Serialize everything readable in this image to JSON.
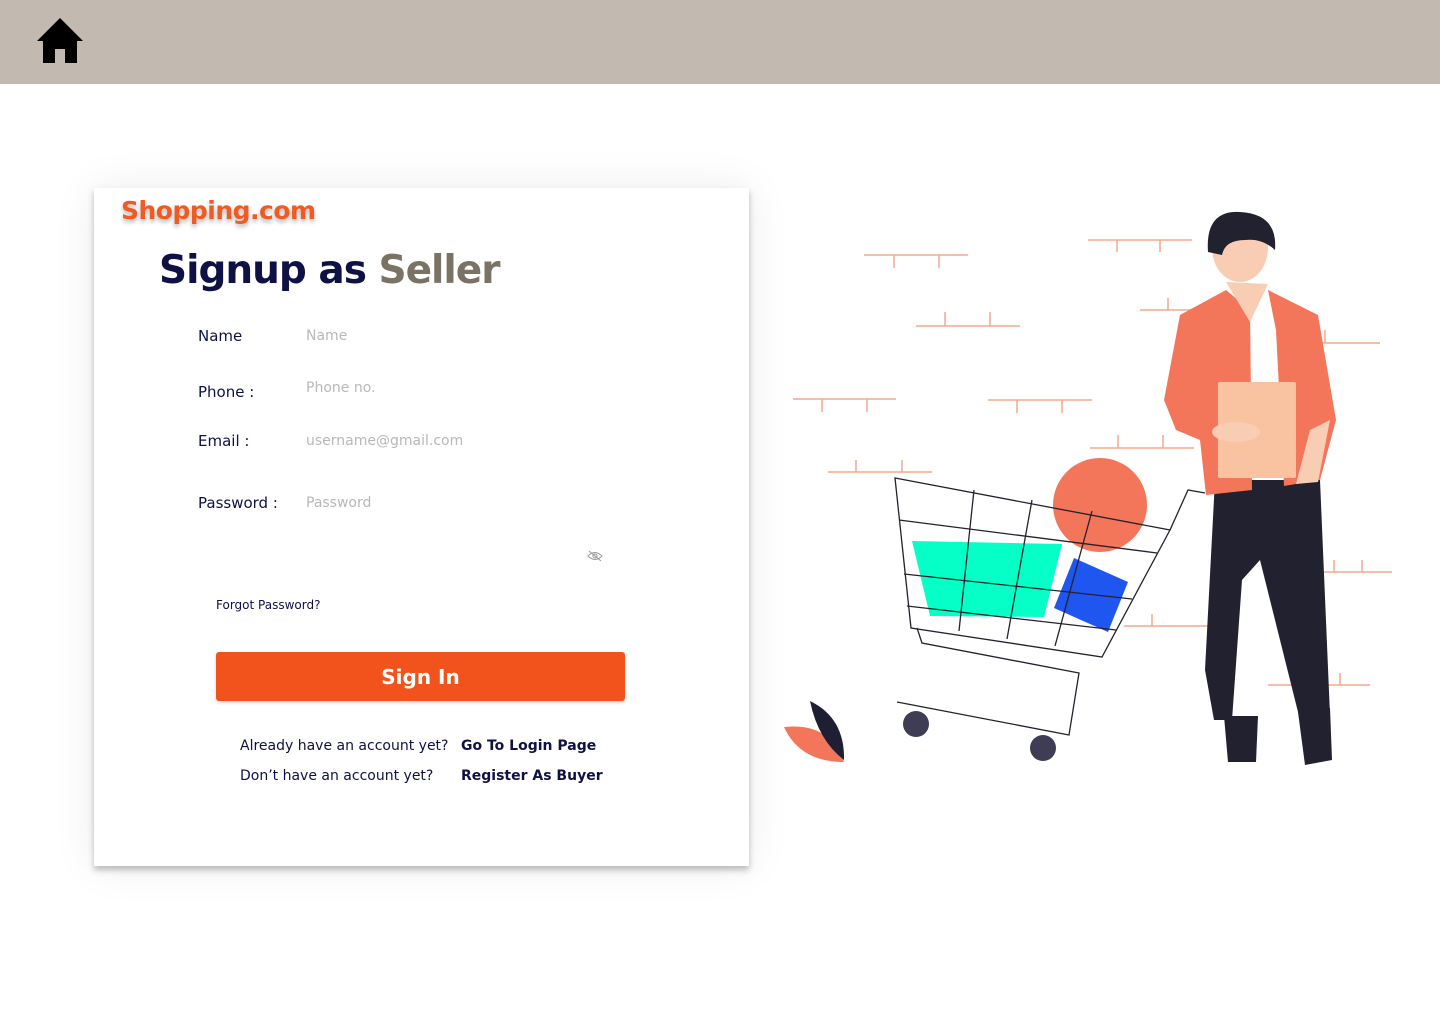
{
  "header": {
    "home_icon": "home-icon"
  },
  "card": {
    "brand": "Shopping.com",
    "title_main": "Signup as",
    "title_accent": "Seller",
    "fields": {
      "name": {
        "label": "Name",
        "placeholder": "Name"
      },
      "phone": {
        "label": "Phone :",
        "placeholder": "Phone no."
      },
      "email": {
        "label": "Email :",
        "placeholder": "username@gmail.com"
      },
      "password": {
        "label": "Password :",
        "placeholder": "Password"
      }
    },
    "password_toggle_icon": "eye-slash-icon",
    "forgot_password": "Forgot Password?",
    "sign_in_label": "Sign In",
    "login_prompt": "Already have an account yet?",
    "login_link": "Go To Login Page",
    "buyer_prompt": "Don’t have an account yet?",
    "buyer_link": "Register As Buyer"
  },
  "colors": {
    "topbar": "#c2bab0",
    "brand": "#f25a22",
    "button": "#f2531d",
    "navy": "#0d1144",
    "accent_text": "#7a7264"
  }
}
